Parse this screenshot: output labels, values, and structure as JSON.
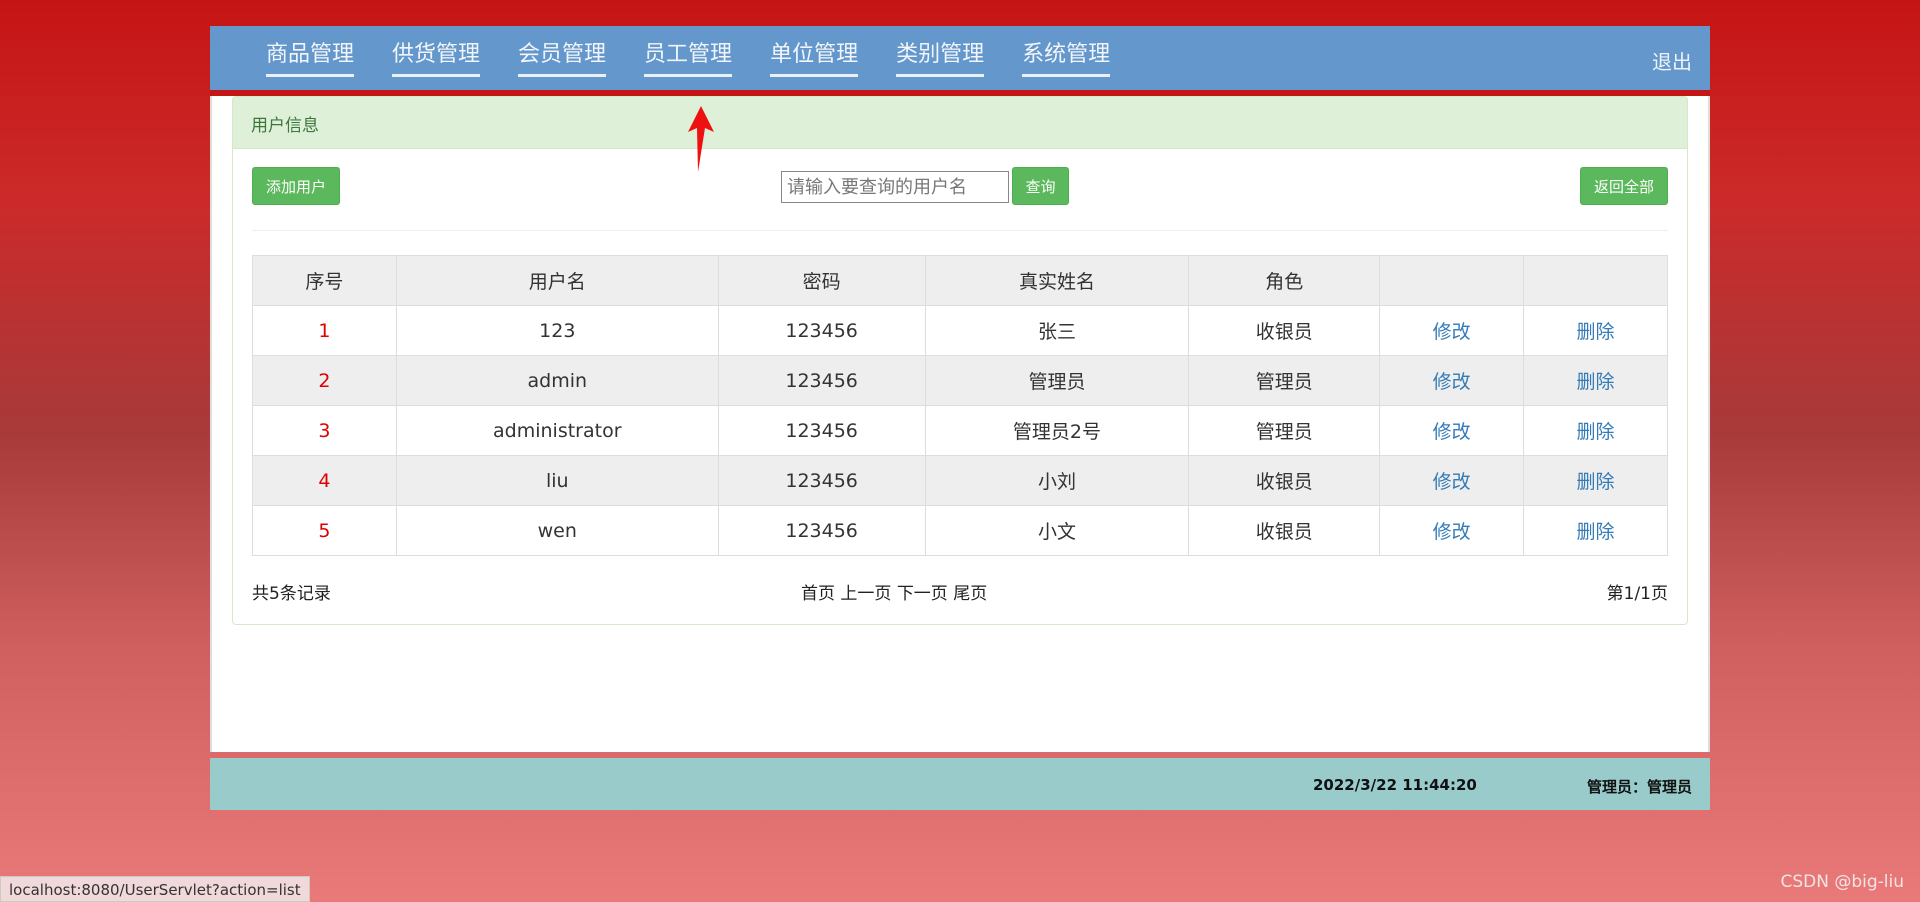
{
  "nav": {
    "items": [
      "商品管理",
      "供货管理",
      "会员管理",
      "员工管理",
      "单位管理",
      "类别管理",
      "系统管理"
    ],
    "logout": "退出"
  },
  "panel": {
    "heading": "用户信息",
    "add_button": "添加用户",
    "search_placeholder": "请输入要查询的用户名",
    "query_button": "查询",
    "back_button": "返回全部"
  },
  "table": {
    "headers": [
      "序号",
      "用户名",
      "密码",
      "真实姓名",
      "角色",
      "",
      ""
    ],
    "rows": [
      {
        "idx": "1",
        "username": "123",
        "password": "123456",
        "realname": "张三",
        "role": "收银员",
        "edit": "修改",
        "del": "删除"
      },
      {
        "idx": "2",
        "username": "admin",
        "password": "123456",
        "realname": "管理员",
        "role": "管理员",
        "edit": "修改",
        "del": "删除"
      },
      {
        "idx": "3",
        "username": "administrator",
        "password": "123456",
        "realname": "管理员2号",
        "role": "管理员",
        "edit": "修改",
        "del": "删除"
      },
      {
        "idx": "4",
        "username": "liu",
        "password": "123456",
        "realname": "小刘",
        "role": "收银员",
        "edit": "修改",
        "del": "删除"
      },
      {
        "idx": "5",
        "username": "wen",
        "password": "123456",
        "realname": "小文",
        "role": "收银员",
        "edit": "修改",
        "del": "删除"
      }
    ]
  },
  "pager": {
    "total": "共5条记录",
    "first": "首页",
    "prev": "上一页",
    "next": "下一页",
    "last": "尾页",
    "page": "第1/1页"
  },
  "footer": {
    "time": "2022/3/22 11:44:20",
    "user": "管理员：管理员"
  },
  "status_url": "localhost:8080/UserServlet?action=list",
  "watermark": "CSDN @big-liu",
  "colors": {
    "nav_bg": "#6497cb",
    "accent_green": "#5cb85c",
    "index_red": "#e00000",
    "link_blue": "#337ab7",
    "footer_bg": "#99cbcb"
  }
}
